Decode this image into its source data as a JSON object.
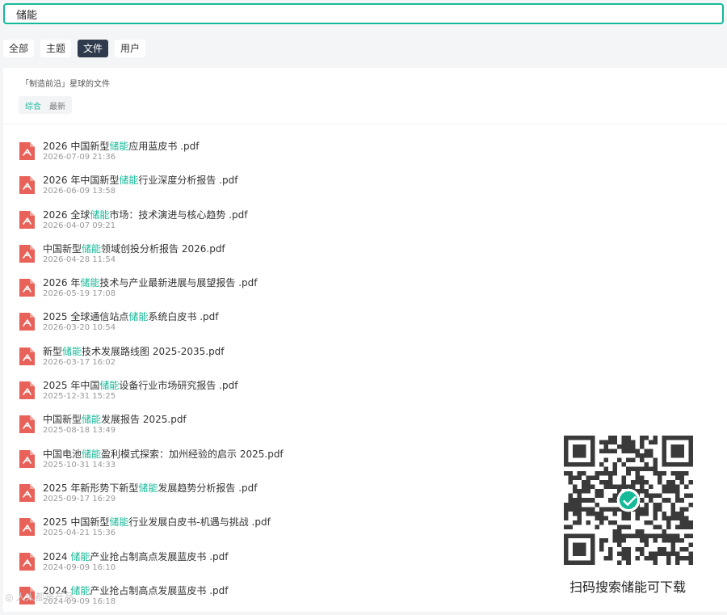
{
  "search": {
    "value": "储能"
  },
  "tabs": [
    {
      "label": "全部",
      "active": false
    },
    {
      "label": "主题",
      "active": false
    },
    {
      "label": "文件",
      "active": true
    },
    {
      "label": "用户",
      "active": false
    }
  ],
  "source_label": "「制造前沿」星球的文件",
  "sort": {
    "options": [
      {
        "label": "综合",
        "active": true
      },
      {
        "label": "最新",
        "active": false
      }
    ]
  },
  "highlight": "储能",
  "files": [
    {
      "before": "2026 中国新型",
      "after": "应用蓝皮书 .pdf",
      "date": "2026-07-09 21:36"
    },
    {
      "before": "2026 年中国新型",
      "after": "行业深度分析报告 .pdf",
      "date": "2026-06-09 13:58"
    },
    {
      "before": "2026 全球",
      "after": "市场：技术演进与核心趋势 .pdf",
      "date": "2026-04-07 09:21"
    },
    {
      "before": "中国新型",
      "after": "领域创投分析报告 2026.pdf",
      "date": "2026-04-28 11:54"
    },
    {
      "before": "2026 年",
      "after": "技术与产业最新进展与展望报告 .pdf",
      "date": "2026-05-19 17:08"
    },
    {
      "before": "2025 全球通信站点",
      "after": "系统白皮书 .pdf",
      "date": "2026-03-20 10:54"
    },
    {
      "before": "新型",
      "after": "技术发展路线图 2025-2035.pdf",
      "date": "2026-03-17 16:02"
    },
    {
      "before": "2025 年中国",
      "after": "设备行业市场研究报告 .pdf",
      "date": "2025-12-31 15:25"
    },
    {
      "before": "中国新型",
      "after": "发展报告 2025.pdf",
      "date": "2025-08-18 13:49"
    },
    {
      "before": "中国电池",
      "after": "盈利模式探索：加州经验的启示 2025.pdf",
      "date": "2025-10-31 14:33"
    },
    {
      "before": "2025 年新形势下新型",
      "after": "发展趋势分析报告 .pdf",
      "date": "2025-09-17 16:29"
    },
    {
      "before": "2025 中国新型",
      "after": "行业发展白皮书-机遇与挑战 .pdf",
      "date": "2025-04-21 15:36"
    },
    {
      "before": "2024 ",
      "after": "产业抢占制高点发展蓝皮书 .pdf",
      "date": "2024-09-09 16:10"
    },
    {
      "before": "2024 ",
      "after": "产业抢占制高点发展蓝皮书 .pdf",
      "date": "2024-09-09 16:18"
    }
  ],
  "qr": {
    "caption": "扫码搜索储能可下载"
  },
  "watermark": {
    "text": "人人都是产品"
  },
  "colors": {
    "accent": "#16b998",
    "pdf_icon": "#e8625a",
    "active_tab": "#2f3b4c",
    "qr_dark": "#3a3a3a"
  }
}
